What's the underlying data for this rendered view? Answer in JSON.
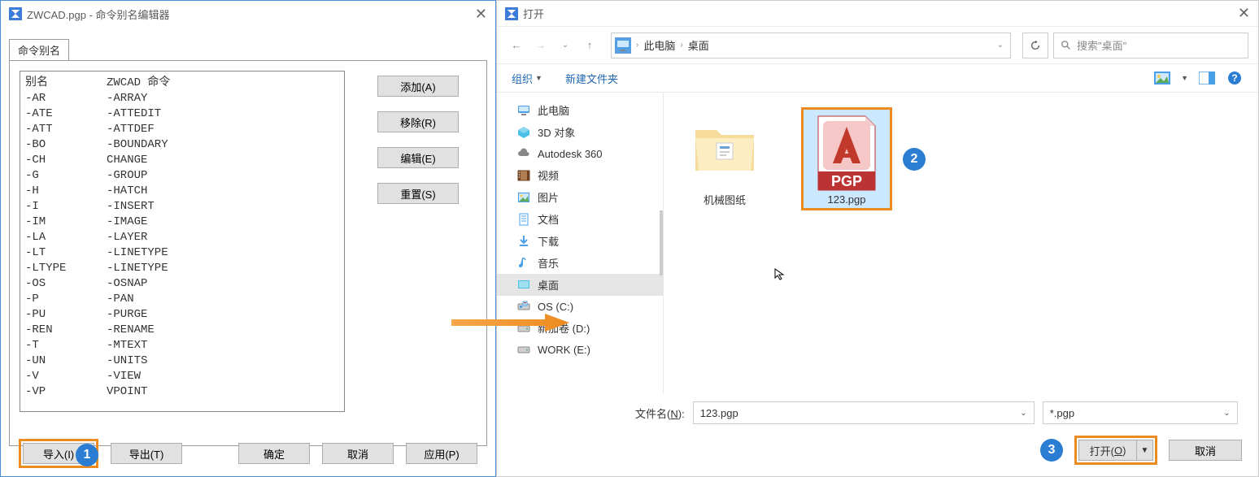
{
  "left": {
    "title": "ZWCAD.pgp - 命令别名编辑器",
    "tab": "命令别名",
    "header_col1": "别名",
    "header_col2": "ZWCAD 命令",
    "rows": [
      {
        "a": "-AR",
        "c": "-ARRAY"
      },
      {
        "a": "-ATE",
        "c": "-ATTEDIT"
      },
      {
        "a": "-ATT",
        "c": "-ATTDEF"
      },
      {
        "a": "-BO",
        "c": "-BOUNDARY"
      },
      {
        "a": "-CH",
        "c": "CHANGE"
      },
      {
        "a": "-G",
        "c": "-GROUP"
      },
      {
        "a": "-H",
        "c": "-HATCH"
      },
      {
        "a": "-I",
        "c": "-INSERT"
      },
      {
        "a": "-IM",
        "c": "-IMAGE"
      },
      {
        "a": "-LA",
        "c": "-LAYER"
      },
      {
        "a": "-LT",
        "c": "-LINETYPE"
      },
      {
        "a": "-LTYPE",
        "c": "-LINETYPE"
      },
      {
        "a": "-OS",
        "c": "-OSNAP"
      },
      {
        "a": "-P",
        "c": "-PAN"
      },
      {
        "a": "-PU",
        "c": "-PURGE"
      },
      {
        "a": "-REN",
        "c": "-RENAME"
      },
      {
        "a": "-T",
        "c": "-MTEXT"
      },
      {
        "a": "-UN",
        "c": "-UNITS"
      },
      {
        "a": "-V",
        "c": "-VIEW"
      },
      {
        "a": "-VP",
        "c": "VPOINT"
      }
    ],
    "btn_add": "添加(A)",
    "btn_remove": "移除(R)",
    "btn_edit": "编辑(E)",
    "btn_reset": "重置(S)",
    "btn_import": "导入(I)",
    "btn_export": "导出(T)",
    "btn_ok": "确定",
    "btn_cancel": "取消",
    "btn_apply": "应用(P)"
  },
  "right": {
    "title": "打开",
    "crumb1": "此电脑",
    "crumb2": "桌面",
    "search_placeholder": "搜索\"桌面\"",
    "organize": "组织",
    "newfolder": "新建文件夹",
    "tree": [
      {
        "icon": "monitor",
        "label": "此电脑"
      },
      {
        "icon": "cube",
        "label": "3D 对象"
      },
      {
        "icon": "cloud",
        "label": "Autodesk 360"
      },
      {
        "icon": "video",
        "label": "视频"
      },
      {
        "icon": "picture",
        "label": "图片"
      },
      {
        "icon": "doc",
        "label": "文档"
      },
      {
        "icon": "download",
        "label": "下载"
      },
      {
        "icon": "music",
        "label": "音乐"
      },
      {
        "icon": "desktop",
        "label": "桌面"
      },
      {
        "icon": "disk-c",
        "label": "OS (C:)"
      },
      {
        "icon": "disk",
        "label": "新加卷 (D:)"
      },
      {
        "icon": "disk",
        "label": "WORK (E:)"
      }
    ],
    "file_folder": "机械图纸",
    "file_pgp": "123.pgp",
    "pgp_badge": "PGP",
    "filename_label_pre": "文件名(",
    "filename_label_u": "N",
    "filename_label_post": "):",
    "filename_value": "123.pgp",
    "filter_value": "*.pgp",
    "open_label_pre": "打开(",
    "open_label_u": "O",
    "open_label_post": ")",
    "cancel2": "取消"
  },
  "callouts": {
    "c1": "1",
    "c2": "2",
    "c3": "3"
  }
}
